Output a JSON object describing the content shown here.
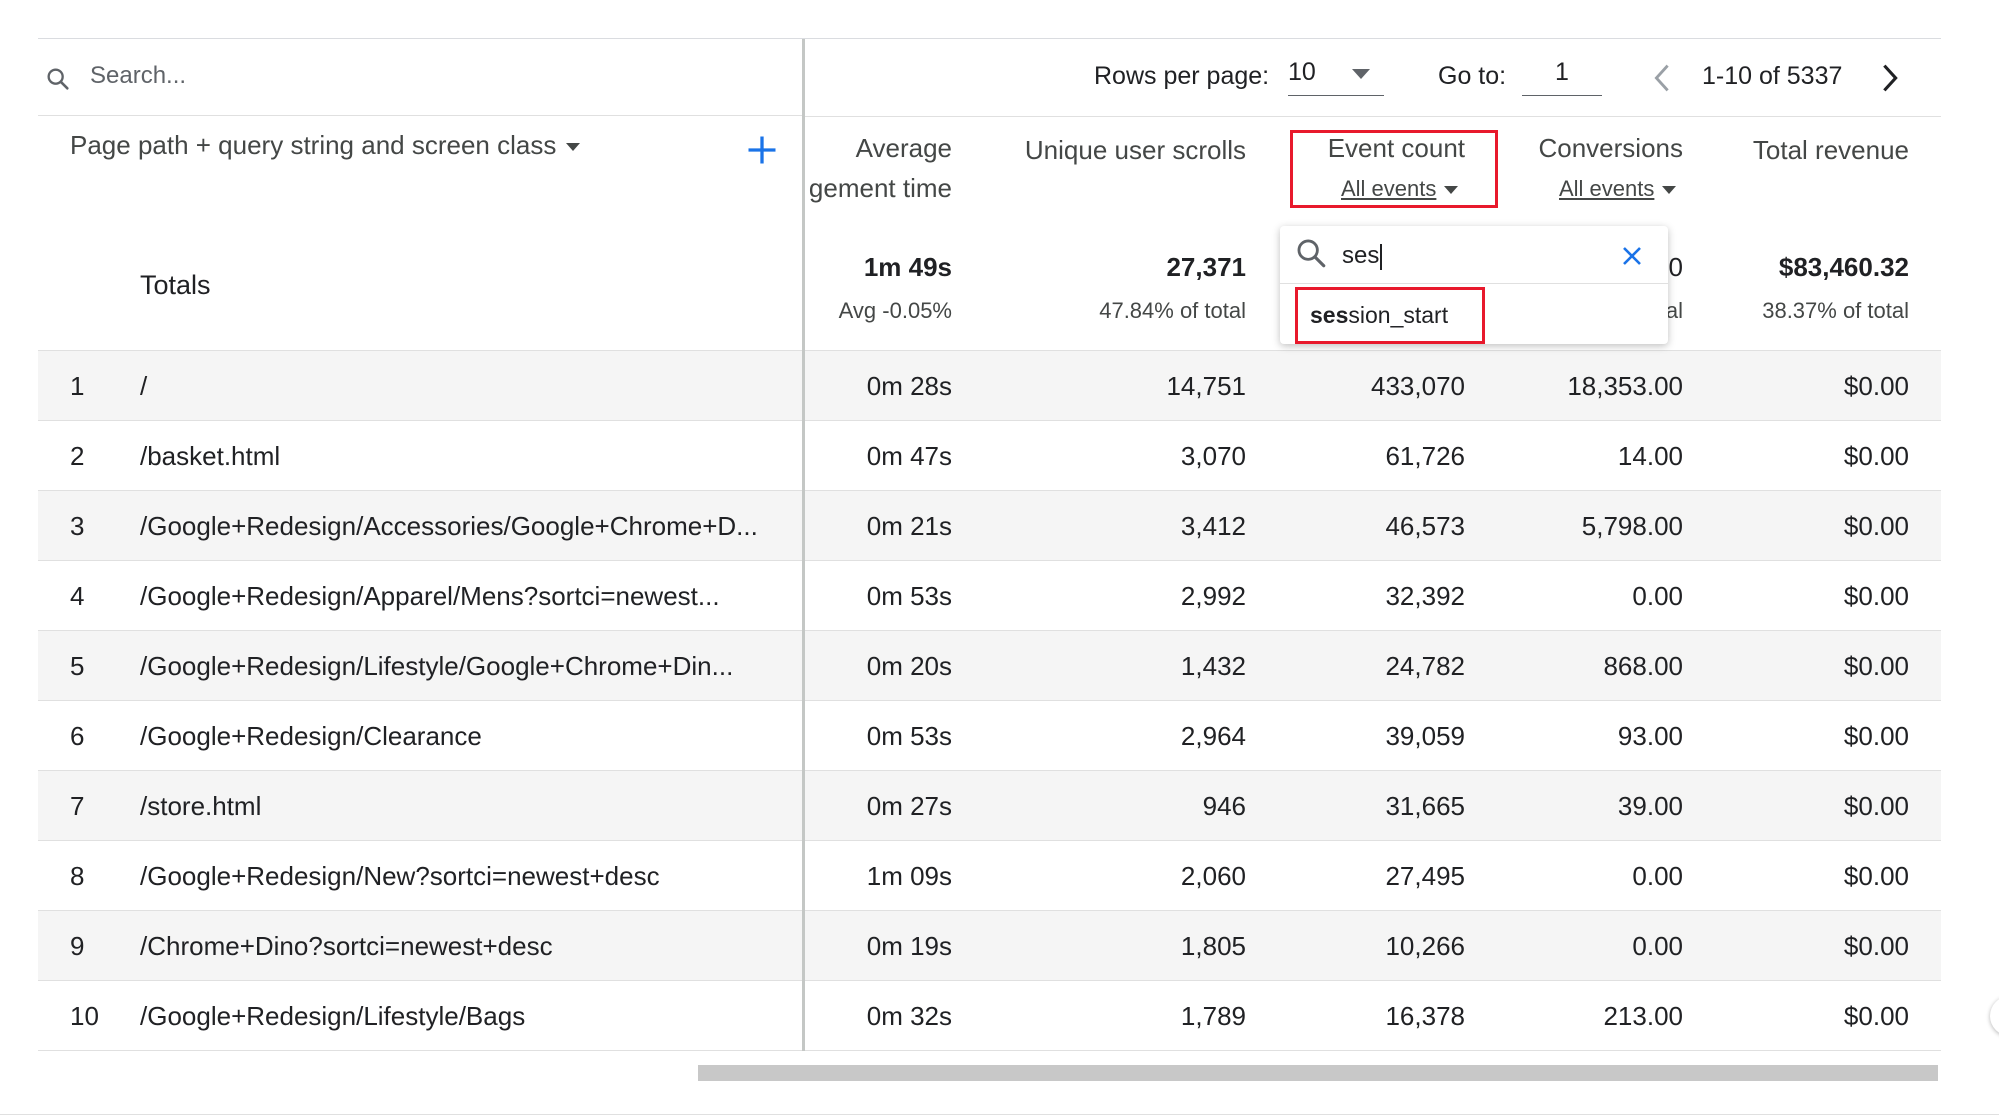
{
  "search": {
    "placeholder": "Search..."
  },
  "dimension": {
    "label": "Page path + query string and screen class"
  },
  "totals_label": "Totals",
  "pagination": {
    "rows_label": "Rows per page:",
    "rows_value": "10",
    "goto_label": "Go to:",
    "goto_value": "1",
    "range": "1-10 of 5337"
  },
  "columns": {
    "avg_line1": "Average",
    "avg_line2": "gement time",
    "scrolls": "Unique user scrolls",
    "events": "Event count",
    "events_filter": "All events",
    "conversions": "Conversions",
    "conversions_filter": "All events",
    "revenue": "Total revenue"
  },
  "totals": {
    "avg": "1m 49s",
    "avg_sub": "Avg -0.05%",
    "scrolls": "27,371",
    "scrolls_sub": "47.84% of total",
    "conv_partial": "0",
    "conv_sub_partial": "al",
    "revenue": "$83,460.32",
    "revenue_sub": "38.37% of total"
  },
  "dropdown": {
    "query": "ses",
    "option_match": "ses",
    "option_rest": "sion_start"
  },
  "rows": [
    {
      "idx": "1",
      "path": "/",
      "avg": "0m 28s",
      "scrolls": "14,751",
      "events": "433,070",
      "conv": "18,353.00",
      "revenue": "$0.00"
    },
    {
      "idx": "2",
      "path": "/basket.html",
      "avg": "0m 47s",
      "scrolls": "3,070",
      "events": "61,726",
      "conv": "14.00",
      "revenue": "$0.00"
    },
    {
      "idx": "3",
      "path": "/Google+Redesign/Accessories/Google+Chrome+D...",
      "avg": "0m 21s",
      "scrolls": "3,412",
      "events": "46,573",
      "conv": "5,798.00",
      "revenue": "$0.00"
    },
    {
      "idx": "4",
      "path": "/Google+Redesign/Apparel/Mens?sortci=newest...",
      "avg": "0m 53s",
      "scrolls": "2,992",
      "events": "32,392",
      "conv": "0.00",
      "revenue": "$0.00"
    },
    {
      "idx": "5",
      "path": "/Google+Redesign/Lifestyle/Google+Chrome+Din...",
      "avg": "0m 20s",
      "scrolls": "1,432",
      "events": "24,782",
      "conv": "868.00",
      "revenue": "$0.00"
    },
    {
      "idx": "6",
      "path": "/Google+Redesign/Clearance",
      "avg": "0m 53s",
      "scrolls": "2,964",
      "events": "39,059",
      "conv": "93.00",
      "revenue": "$0.00"
    },
    {
      "idx": "7",
      "path": "/store.html",
      "avg": "0m 27s",
      "scrolls": "946",
      "events": "31,665",
      "conv": "39.00",
      "revenue": "$0.00"
    },
    {
      "idx": "8",
      "path": "/Google+Redesign/New?sortci=newest+desc",
      "avg": "1m 09s",
      "scrolls": "2,060",
      "events": "27,495",
      "conv": "0.00",
      "revenue": "$0.00"
    },
    {
      "idx": "9",
      "path": "/Chrome+Dino?sortci=newest+desc",
      "avg": "0m 19s",
      "scrolls": "1,805",
      "events": "10,266",
      "conv": "0.00",
      "revenue": "$0.00"
    },
    {
      "idx": "10",
      "path": "/Google+Redesign/Lifestyle/Bags",
      "avg": "0m 32s",
      "scrolls": "1,789",
      "events": "16,378",
      "conv": "213.00",
      "revenue": "$0.00"
    }
  ],
  "colors": {
    "accent": "#1a73e8",
    "highlight": "#e8192c"
  }
}
